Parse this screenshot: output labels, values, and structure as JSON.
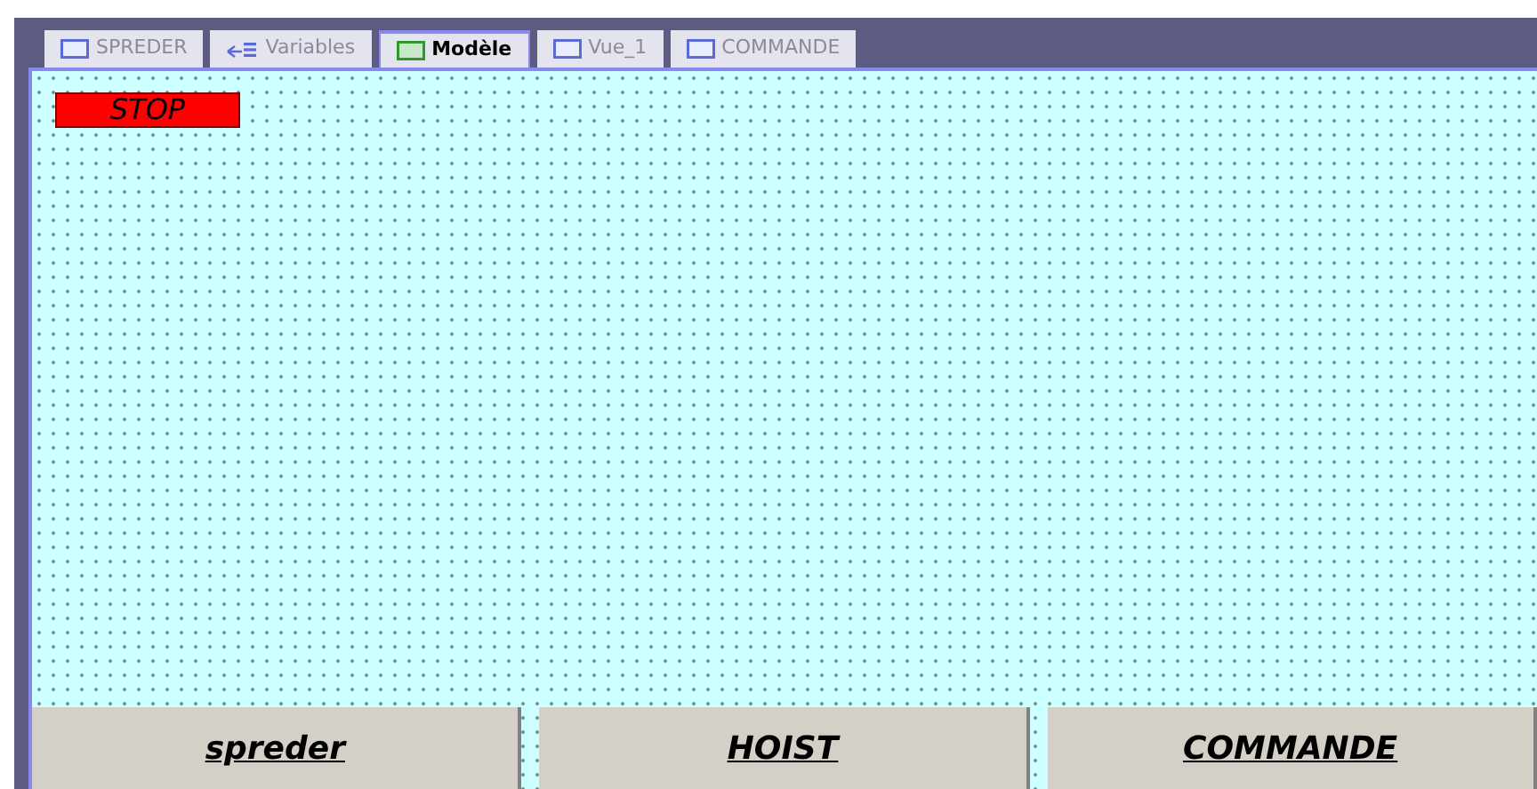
{
  "tabs": [
    {
      "label": "SPREDER",
      "kind": "screen",
      "selected": false
    },
    {
      "label": "Variables",
      "kind": "variables",
      "selected": false
    },
    {
      "label": "Modèle",
      "kind": "screen",
      "selected": true
    },
    {
      "label": "Vue_1",
      "kind": "screen",
      "selected": false
    },
    {
      "label": "COMMANDE",
      "kind": "screen",
      "selected": false
    }
  ],
  "stop_button": {
    "label": "STOP"
  },
  "bottom_buttons": [
    {
      "label": "spreder"
    },
    {
      "label": "HOIST"
    },
    {
      "label": "COMMANDE"
    }
  ]
}
